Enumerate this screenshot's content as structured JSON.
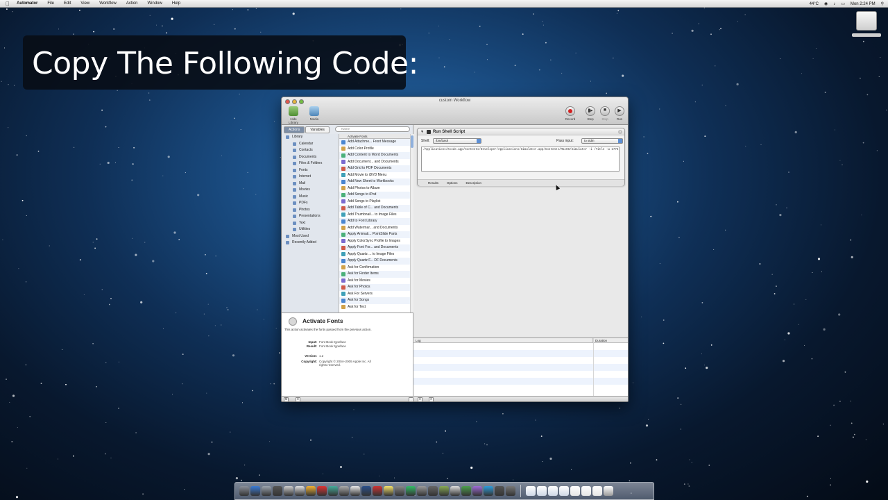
{
  "menubar": {
    "app": "Automator",
    "items": [
      "File",
      "Edit",
      "View",
      "Workflow",
      "Action",
      "Window",
      "Help"
    ],
    "temperature": "44°C",
    "clock": "Mon 2:24 PM"
  },
  "caption": "Copy The Following Code:",
  "window": {
    "title": "custom Workflow",
    "toolbar": {
      "hide_library": "Hide Library",
      "media": "Media",
      "record": "Record",
      "step": "Step",
      "stop": "Stop",
      "run": "Run"
    },
    "library": {
      "tabs": [
        "Actions",
        "Variables"
      ],
      "search_placeholder": "Name",
      "categories": [
        {
          "label": "Library",
          "level": 0
        },
        {
          "label": "Calendar",
          "level": 1
        },
        {
          "label": "Contacts",
          "level": 1
        },
        {
          "label": "Documents",
          "level": 1
        },
        {
          "label": "Files & Folders",
          "level": 1
        },
        {
          "label": "Fonts",
          "level": 1
        },
        {
          "label": "Internet",
          "level": 1
        },
        {
          "label": "Mail",
          "level": 1
        },
        {
          "label": "Movies",
          "level": 1
        },
        {
          "label": "Music",
          "level": 1
        },
        {
          "label": "PDFs",
          "level": 1
        },
        {
          "label": "Photos",
          "level": 1
        },
        {
          "label": "Presentations",
          "level": 1
        },
        {
          "label": "Text",
          "level": 1
        },
        {
          "label": "Utilities",
          "level": 1
        },
        {
          "label": "Most Used",
          "level": 0
        },
        {
          "label": "Recently Added",
          "level": 0
        }
      ],
      "actions_header": "Activate Fonts",
      "actions": [
        "Add Attachme... Front Message",
        "Add Color Profile",
        "Add Content to Word Documents",
        "Add Document... and Documents",
        "Add Grid to PDF Documents",
        "Add Movie to iDVD Menu",
        "Add New Sheet to Workbooks",
        "Add Photos to Album",
        "Add Songs to iPod",
        "Add Songs to Playlist",
        "Add Table of C... and Documents",
        "Add Thumbnail... to Image Files",
        "Add to Font Library",
        "Add Watermar... and Documents",
        "Apply Animati... PointSlide Parts",
        "Apply ColorSync Profile to Images",
        "Apply Font For... and Documents",
        "Apply Quartz ... to Image Files",
        "Apply Quartz F... DF Documents",
        "Ask for Confirmation",
        "Ask for Finder Items",
        "Ask for Movies",
        "Ask for Photos",
        "Ask For Servers",
        "Ask for Songs",
        "Ask for Text"
      ]
    },
    "description": {
      "title": "Activate Fonts",
      "text": "This action activates the fonts passed from the previous action.",
      "input_label": "Input:",
      "input_value": "Font Book typeface",
      "result_label": "Result:",
      "result_value": "Font Book typeface",
      "version_label": "Version:",
      "version_value": "1.2",
      "copyright_label": "Copyright:",
      "copyright_value": "Copyright © 2004–2009 Apple Inc. All rights reserved."
    },
    "action": {
      "title": "Run Shell Script",
      "shell_label": "Shell:",
      "shell_value": "/bin/bash",
      "pass_input_label": "Pass input:",
      "pass_input_value": "to stdin",
      "script": "/Applications/Xcode.app/Contents/Developer/Applications/Simulator.app/Contents/MacOS/Simulator -i /Title -w 1776",
      "tabs": [
        "Results",
        "Options",
        "Description"
      ]
    },
    "log": {
      "col_log": "Log",
      "col_duration": "Duration"
    }
  }
}
